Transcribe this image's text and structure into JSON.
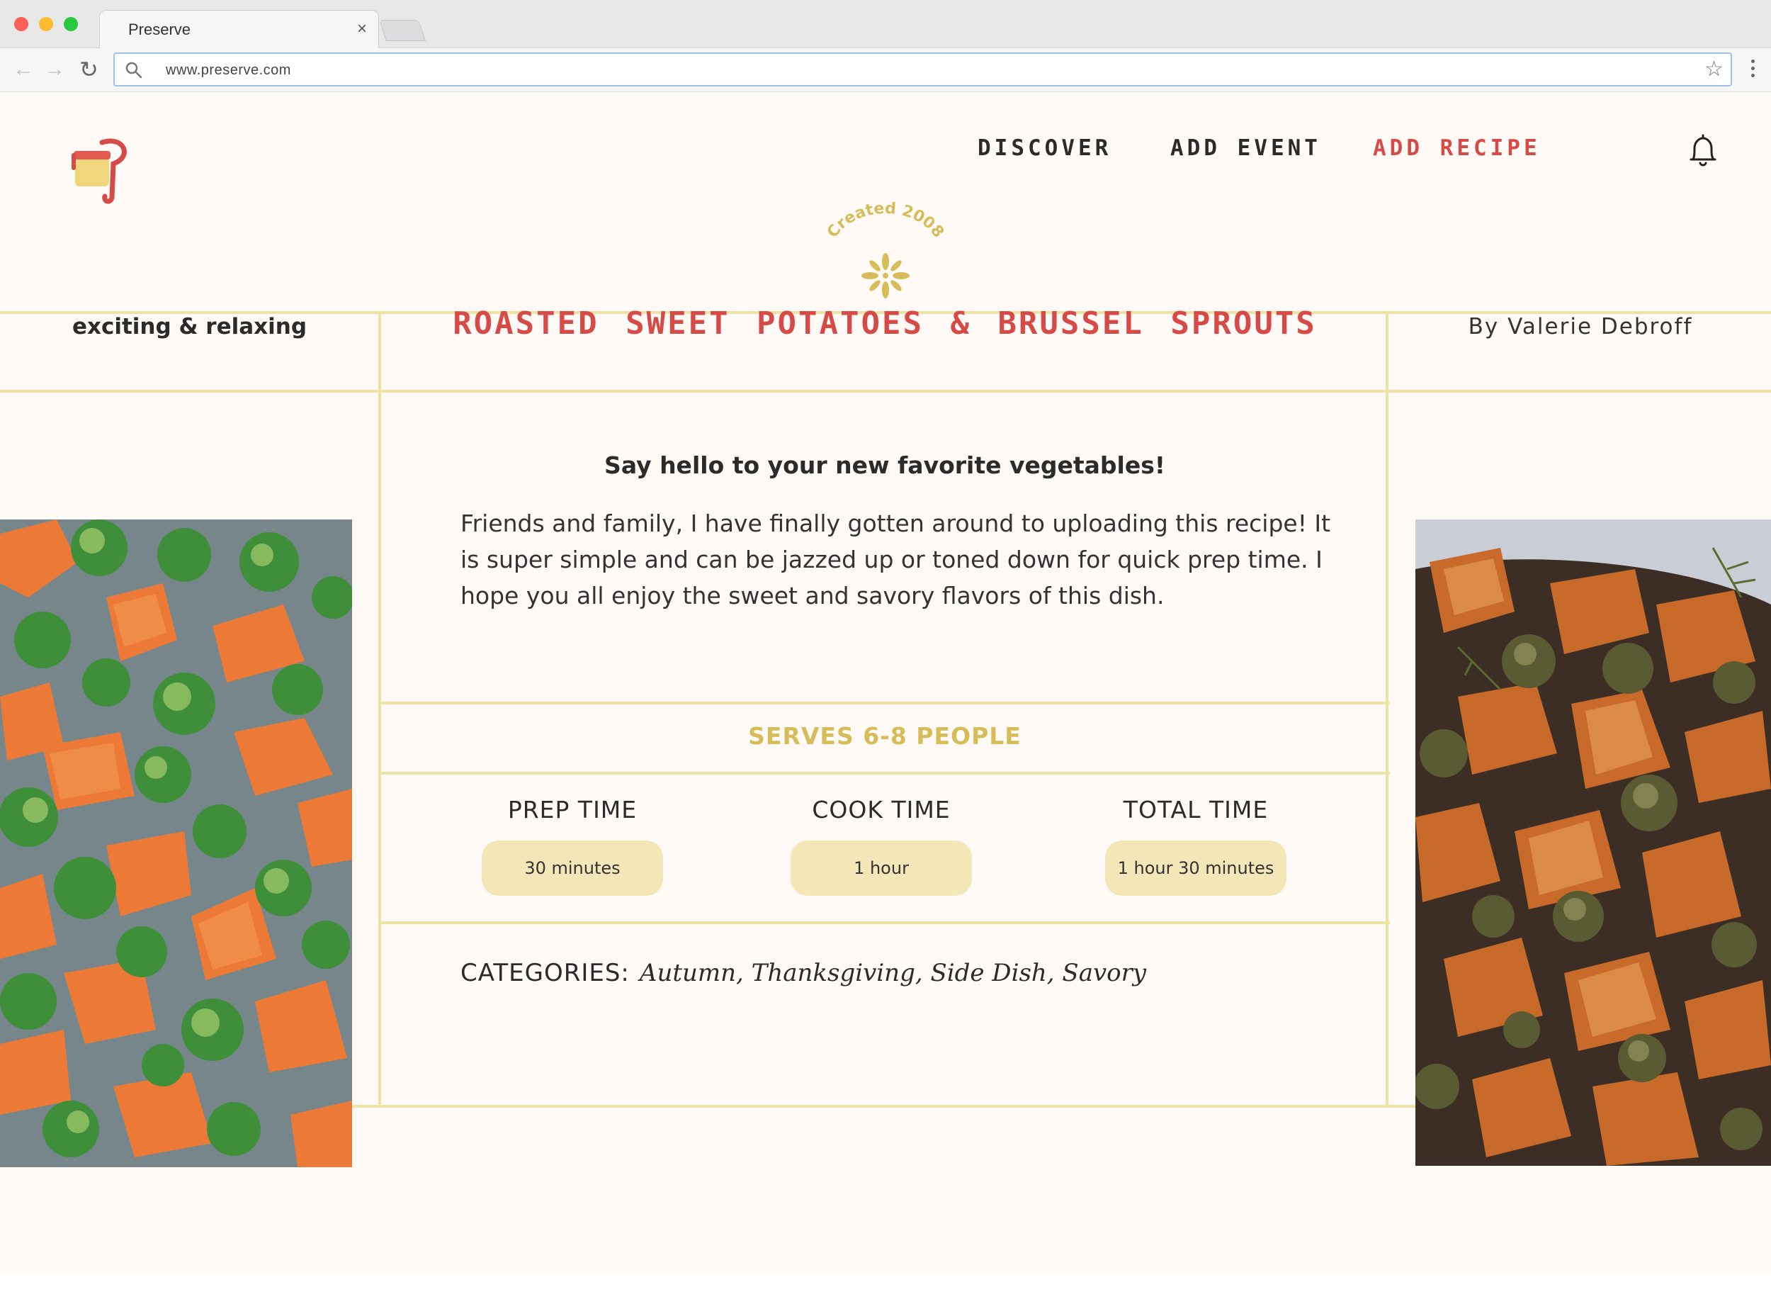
{
  "browser": {
    "tab_title": "Preserve",
    "tab_close": "×",
    "url": "www.preserve.com"
  },
  "nav": {
    "items": [
      {
        "label": "DISCOVER"
      },
      {
        "label": "ADD EVENT"
      },
      {
        "label": "ADD RECIPE",
        "active": true
      }
    ]
  },
  "badge": {
    "text": "Created 2008"
  },
  "header": {
    "tagline": "exciting & relaxing",
    "title": "ROASTED SWEET POTATOES & BRUSSEL SPROUTS",
    "author": "By Valerie Debroff"
  },
  "recipe": {
    "subtitle": "Say hello to your new favorite vegetables!",
    "description": "Friends and family, I have finally gotten around to uploading this recipe! It is super simple and can be jazzed up or toned down for quick prep time. I hope you all enjoy the sweet and savory flavors of this dish.",
    "serves": "SERVES 6-8 PEOPLE",
    "times": [
      {
        "label": "PREP TIME",
        "value": "30 minutes"
      },
      {
        "label": "COOK TIME",
        "value": "1 hour"
      },
      {
        "label": "TOTAL TIME",
        "value": "1 hour 30 minutes"
      }
    ],
    "categories_label": "CATEGORIES:",
    "categories": "Autumn, Thanksgiving, Side Dish, Savory"
  },
  "images": {
    "left": "roasted-vegetables-tray-photo",
    "right": "roasted-vegetables-bowl-photo"
  },
  "colors": {
    "accent_red": "#d64a48",
    "accent_gold": "#d7bd59",
    "divider": "#efe2a5",
    "pill": "#f3e6b7",
    "page_bg": "#fffaf6"
  },
  "icons": [
    "search-icon",
    "star-icon",
    "bell-icon",
    "back-arrow-icon",
    "forward-arrow-icon",
    "reload-icon",
    "menu-dots-icon",
    "jar-logo-icon",
    "flower-icon"
  ]
}
